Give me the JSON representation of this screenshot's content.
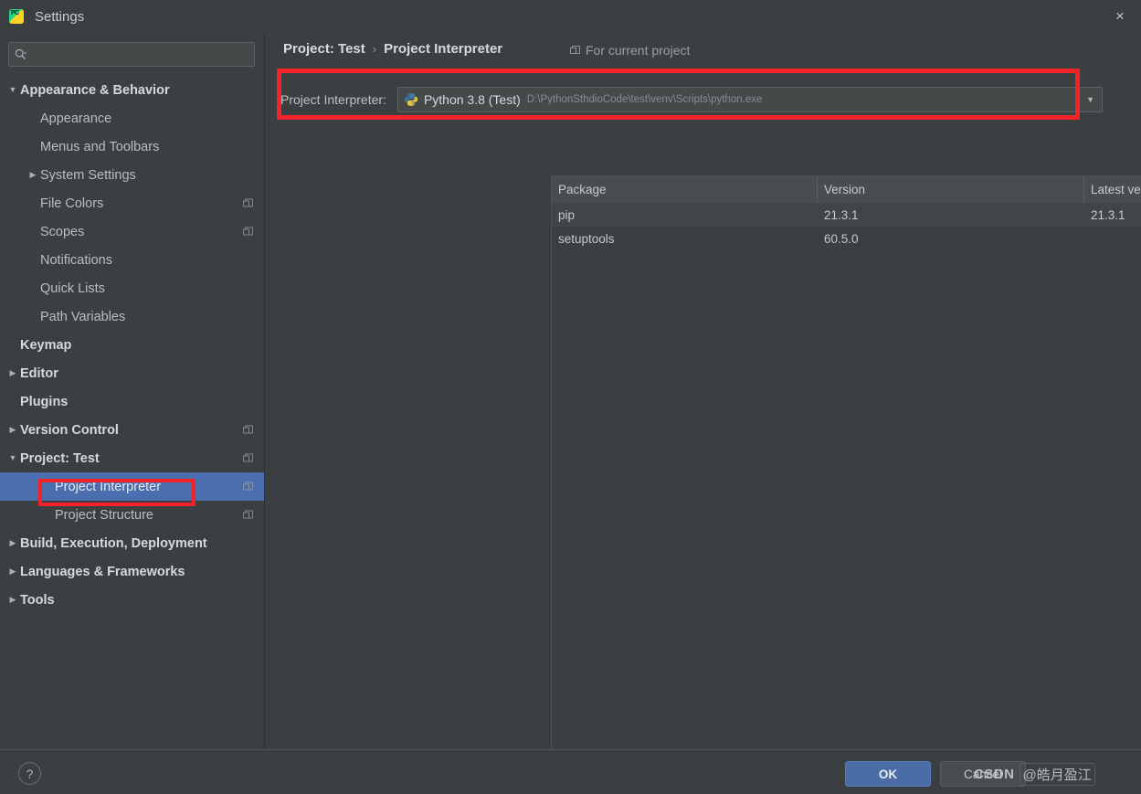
{
  "window": {
    "title": "Settings",
    "app_icon": "pycharm-icon",
    "close_label": "×"
  },
  "sidebar": {
    "search": {
      "value": "",
      "placeholder": "",
      "icon": "search-icon"
    },
    "items": [
      {
        "label": "Appearance & Behavior",
        "level": 0,
        "arrow": "▼",
        "bold": true,
        "modified": false,
        "selected": false
      },
      {
        "label": "Appearance",
        "level": 1,
        "arrow": "",
        "bold": false,
        "modified": false,
        "selected": false
      },
      {
        "label": "Menus and Toolbars",
        "level": 1,
        "arrow": "",
        "bold": false,
        "modified": false,
        "selected": false
      },
      {
        "label": "System Settings",
        "level": 1,
        "arrow": "▶",
        "bold": false,
        "modified": false,
        "selected": false
      },
      {
        "label": "File Colors",
        "level": 1,
        "arrow": "",
        "bold": false,
        "modified": true,
        "selected": false
      },
      {
        "label": "Scopes",
        "level": 1,
        "arrow": "",
        "bold": false,
        "modified": true,
        "selected": false
      },
      {
        "label": "Notifications",
        "level": 1,
        "arrow": "",
        "bold": false,
        "modified": false,
        "selected": false
      },
      {
        "label": "Quick Lists",
        "level": 1,
        "arrow": "",
        "bold": false,
        "modified": false,
        "selected": false
      },
      {
        "label": "Path Variables",
        "level": 1,
        "arrow": "",
        "bold": false,
        "modified": false,
        "selected": false
      },
      {
        "label": "Keymap",
        "level": 0,
        "arrow": "",
        "bold": true,
        "modified": false,
        "selected": false
      },
      {
        "label": "Editor",
        "level": 0,
        "arrow": "▶",
        "bold": true,
        "modified": false,
        "selected": false
      },
      {
        "label": "Plugins",
        "level": 0,
        "arrow": "",
        "bold": true,
        "modified": false,
        "selected": false
      },
      {
        "label": "Version Control",
        "level": 0,
        "arrow": "▶",
        "bold": true,
        "modified": true,
        "selected": false
      },
      {
        "label": "Project: Test",
        "level": 0,
        "arrow": "▼",
        "bold": true,
        "modified": true,
        "selected": false
      },
      {
        "label": "Project Interpreter",
        "level": 2,
        "arrow": "",
        "bold": false,
        "modified": true,
        "selected": true
      },
      {
        "label": "Project Structure",
        "level": 2,
        "arrow": "",
        "bold": false,
        "modified": true,
        "selected": false
      },
      {
        "label": "Build, Execution, Deployment",
        "level": 0,
        "arrow": "▶",
        "bold": true,
        "modified": false,
        "selected": false
      },
      {
        "label": "Languages & Frameworks",
        "level": 0,
        "arrow": "▶",
        "bold": true,
        "modified": false,
        "selected": false
      },
      {
        "label": "Tools",
        "level": 0,
        "arrow": "▶",
        "bold": true,
        "modified": false,
        "selected": false
      }
    ]
  },
  "breadcrumb": {
    "parent": "Project: Test",
    "separator": "›",
    "current": "Project Interpreter",
    "scope_note": "For current project"
  },
  "interpreter": {
    "label": "Project Interpreter:",
    "name": "Python 3.8 (Test)",
    "path": "D:\\PythonSthdioCode\\test\\venv\\Scripts\\python.exe",
    "dropdown_arrow": "▼",
    "gear_icon": "gear-icon"
  },
  "packages": {
    "columns": [
      "Package",
      "Version",
      "Latest version"
    ],
    "rows": [
      {
        "package": "pip",
        "version": "21.3.1",
        "latest": "21.3.1"
      },
      {
        "package": "setuptools",
        "version": "60.5.0",
        "latest": ""
      }
    ],
    "tools": [
      {
        "name": "add-package-button",
        "glyph": "+",
        "enabled": true
      },
      {
        "name": "remove-package-button",
        "glyph": "—",
        "enabled": false
      },
      {
        "name": "upgrade-package-button",
        "glyph": "▲",
        "enabled": false
      },
      {
        "name": "show-early-releases-button",
        "glyph": "eye",
        "enabled": true
      }
    ]
  },
  "footer": {
    "help_label": "?",
    "ok_label": "OK",
    "cancel_label": "Cancel",
    "watermark_brand": "CSDN",
    "watermark_handle": "@皓月盈江"
  },
  "colors": {
    "background": "#3c3f41",
    "selection_blue": "#4b6eaf",
    "primary_button": "#4a6da7",
    "annotation_red": "#f4232a"
  }
}
